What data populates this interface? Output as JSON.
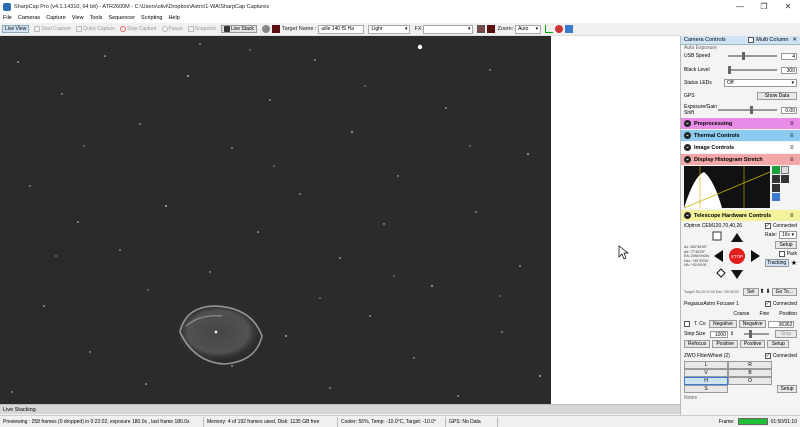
{
  "window": {
    "title": "SharpCap Pro (v4.1.14310, 64 bit) - ATR2600M - C:\\Users\\olivi\\Dropbox\\Astro\\1-WA\\SharpCap Captures",
    "minimize": "—",
    "maximize": "❐",
    "close": "✕"
  },
  "menu": [
    "File",
    "Cameras",
    "Capture",
    "View",
    "Tools",
    "Sequencer",
    "Scripting",
    "Help"
  ],
  "toolbar": {
    "live_view": "Live View",
    "start_capture": "Start Capture",
    "quick_capture": "Quick Capture",
    "stop_capture": "Stop Capture",
    "pause": "Pause",
    "snapshot": "Snapshot",
    "live_stack": "Live Stack",
    "target_label": "Target Name :",
    "target_value": "uille 140 fS Ha",
    "frame_type": "Light",
    "fx_label": "FX",
    "zoom_label": "Zoom:",
    "zoom_value": "Auto"
  },
  "stack_label": "Live Stacking",
  "status": {
    "previewing": "Previewing : 258 frames (0 dropped) in 0:22:02, exposure 180.0s , last frame 180.0s",
    "memory": "Memory: 4 of 192 frames used, Disk: 1135 GB free",
    "cooler": "Cooler: 55%, Temp: -10.0°C, Target: -10.0°",
    "gps": "GPS: No Data",
    "frame_label": "Frame:",
    "time": "01:50/01:10"
  },
  "panel": {
    "title": "Camera Controls",
    "multi_column": "Multi Column",
    "auto_exposure": "Auto Exposure",
    "usb_speed_label": "USB Speed",
    "usb_speed_value": "4",
    "black_level_label": "Black Level",
    "black_level_value": "300",
    "status_leds_label": "Status LEDs",
    "status_leds_value": "Off",
    "gps_label": "GPS",
    "show_data": "Show Data",
    "exposure_gain_label": "Exposure/Gain Shift",
    "exposure_gain_value": "0.00",
    "sections": {
      "preprocessing": "Preprocessing",
      "thermal": "Thermal Controls",
      "image": "Image Controls",
      "histogram": "Display Histogram Stretch",
      "telescope": "Telescope Hardware Controls"
    },
    "mount": {
      "name": "iOptron CEM120,70,40,26",
      "connected": "Connected",
      "rate_label": "Rate:",
      "rate_value": "16x",
      "setup": "Setup",
      "park": "Park",
      "stop": "STOP",
      "tracking": "Tracking",
      "set": "Set",
      "goto": "Go To...",
      "coords": [
        "Az: 183°45'00\"",
        "Alt: 77°45'00\"",
        "RA: 20h47m00s",
        "Dec: +30°45'00\"",
        "HA: +00:00:00"
      ],
      "footer": "Target: RA 20:47:00  Dec +30:45:00"
    },
    "focuser": {
      "name": "PegasusAstro Focuser 1",
      "connected": "Connected",
      "coarse": "Coarse",
      "fine": "Fine",
      "position": "Position",
      "t_comp": "T. Co",
      "negative": "Negative",
      "position_value": "36362",
      "step_size_label": "Step Size",
      "step_size_value": "1000",
      "stop": "Stop",
      "refocus": "Refocus",
      "positive": "Positive",
      "setup": "Setup"
    },
    "filterwheel": {
      "name": "ZWO FilterWheel (2)",
      "connected": "Connected",
      "filters": [
        "L",
        "R",
        "V",
        "B",
        "H",
        "O",
        "S"
      ],
      "setup": "Setup",
      "notes": "Notes"
    }
  }
}
